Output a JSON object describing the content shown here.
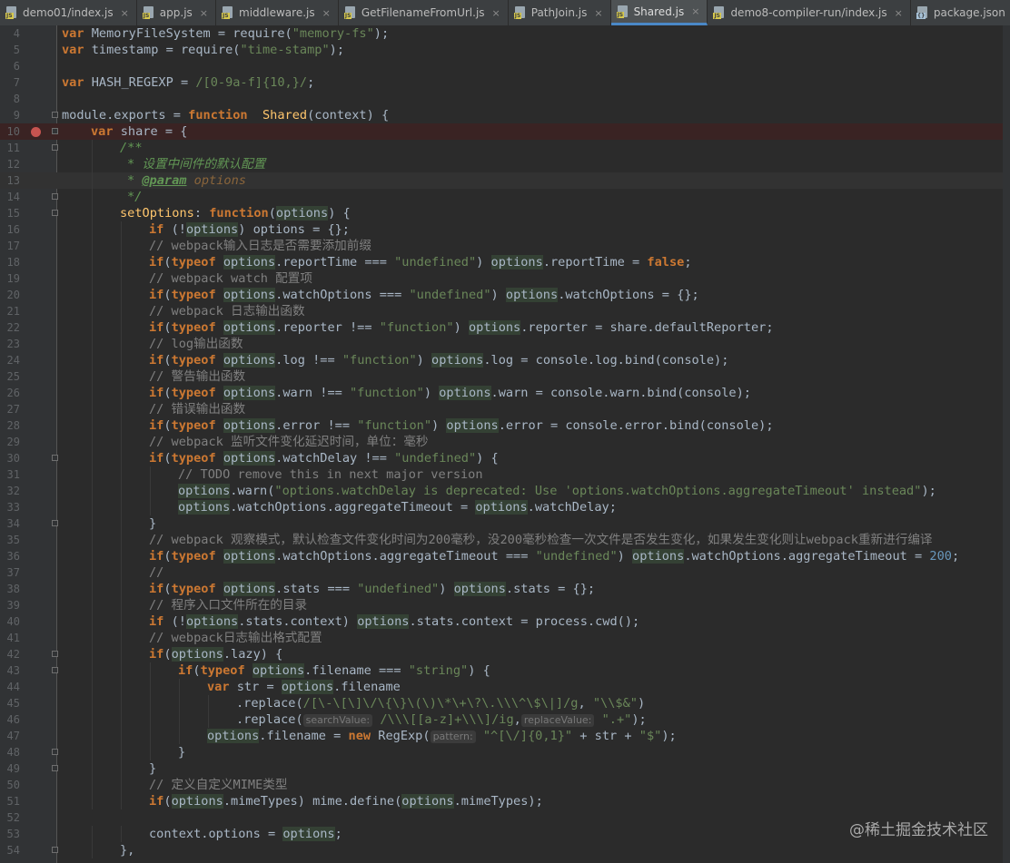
{
  "tabs": [
    {
      "label": "demo01/index.js",
      "icon": "js-file-icon",
      "active": false
    },
    {
      "label": "app.js",
      "icon": "js-file-icon",
      "active": false
    },
    {
      "label": "middleware.js",
      "icon": "js-file-icon",
      "active": false
    },
    {
      "label": "GetFilenameFromUrl.js",
      "icon": "js-file-icon",
      "active": false
    },
    {
      "label": "PathJoin.js",
      "icon": "js-file-icon",
      "active": false
    },
    {
      "label": "Shared.js",
      "icon": "js-file-icon",
      "active": true
    },
    {
      "label": "demo8-compiler-run/index.js",
      "icon": "js-file-icon",
      "active": false
    },
    {
      "label": "package.json",
      "icon": "json-file-icon",
      "active": false
    }
  ],
  "tab_close_glyph": "×",
  "line_numbers": [
    "4",
    "5",
    "6",
    "7",
    "8",
    "9",
    "10",
    "11",
    "12",
    "13",
    "14",
    "15",
    "16",
    "17",
    "18",
    "19",
    "20",
    "21",
    "22",
    "23",
    "24",
    "25",
    "26",
    "27",
    "28",
    "29",
    "30",
    "31",
    "32",
    "33",
    "34",
    "35",
    "36",
    "37",
    "38",
    "39",
    "40",
    "41",
    "42",
    "43",
    "44",
    "45",
    "46",
    "47",
    "48",
    "49",
    "50",
    "51",
    "52",
    "53",
    "54"
  ],
  "breakpoint_line": "10",
  "tokens": {
    "l4": [
      "var",
      "MemoryFileSystem = require(",
      "\"memory-fs\"",
      ");"
    ],
    "l5": [
      "var",
      "timestamp = require(",
      "\"time-stamp\"",
      ");"
    ],
    "l7": [
      "var",
      "HASH_REGEXP = ",
      "/[0-9a-f]{10,}/",
      ";"
    ],
    "l9": [
      "module.exports = ",
      "function",
      " ",
      "Shared",
      "(context) {"
    ],
    "l10": [
      "var",
      "share = {"
    ],
    "l11": [
      "/**"
    ],
    "l12": [
      "* 设置中间件的默认配置"
    ],
    "l13": [
      "*",
      "@param",
      "options"
    ],
    "l14": [
      "*/"
    ],
    "l15": [
      "setOptions",
      ": ",
      "function",
      "(",
      "options",
      ") {"
    ],
    "l16": [
      "if",
      "(!",
      "options",
      ") options = {};"
    ],
    "l17": [
      "// webpack输入日志是否需要添加前缀"
    ],
    "l18": [
      "if",
      "(",
      "typeof",
      "options",
      ".reportTime === ",
      "\"undefined\"",
      ") ",
      "options",
      ".reportTime = ",
      "false",
      ";"
    ],
    "l19": [
      "// webpack watch 配置项"
    ],
    "l20": [
      "if",
      "(",
      "typeof",
      "options",
      ".watchOptions === ",
      "\"undefined\"",
      ") ",
      "options",
      ".watchOptions = {};"
    ],
    "l21": [
      "// webpack 日志输出函数"
    ],
    "l22": [
      "if",
      "(",
      "typeof",
      "options",
      ".reporter !== ",
      "\"function\"",
      ") ",
      "options",
      ".reporter = share.defaultReporter;"
    ],
    "l23": [
      "// log输出函数"
    ],
    "l24": [
      "if",
      "(",
      "typeof",
      "options",
      ".log !== ",
      "\"function\"",
      ") ",
      "options",
      ".log = console.log.bind(console);"
    ],
    "l25": [
      "// 警告输出函数"
    ],
    "l26": [
      "if",
      "(",
      "typeof",
      "options",
      ".warn !== ",
      "\"function\"",
      ") ",
      "options",
      ".warn = console.warn.bind(console);"
    ],
    "l27": [
      "// 错误输出函数"
    ],
    "l28": [
      "if",
      "(",
      "typeof",
      "options",
      ".error !== ",
      "\"function\"",
      ") ",
      "options",
      ".error = console.error.bind(console);"
    ],
    "l29": [
      "// webpack 监听文件变化延迟时间，单位：毫秒"
    ],
    "l30": [
      "if",
      "(",
      "typeof",
      "options",
      ".watchDelay !== ",
      "\"undefined\"",
      ") {"
    ],
    "l31": [
      "// TODO remove this in next major version"
    ],
    "l32": [
      "options",
      ".warn(",
      "\"options.watchDelay is deprecated: Use 'options.watchOptions.aggregateTimeout' instead\"",
      ");"
    ],
    "l33": [
      "options",
      ".watchOptions.aggregateTimeout = ",
      "options",
      ".watchDelay;"
    ],
    "l34": [
      "}"
    ],
    "l35": [
      "// webpack 观察模式，默认检查文件变化时间为200毫秒，没200毫秒检查一次文件是否发生变化，如果发生变化则让webpack重新进行编译"
    ],
    "l36": [
      "if",
      "(",
      "typeof",
      "options",
      ".watchOptions.aggregateTimeout === ",
      "\"undefined\"",
      ") ",
      "options",
      ".watchOptions.aggregateTimeout = ",
      "200",
      ";"
    ],
    "l37": [
      "//"
    ],
    "l38": [
      "if",
      "(",
      "typeof",
      "options",
      ".stats === ",
      "\"undefined\"",
      ") ",
      "options",
      ".stats = {};"
    ],
    "l39": [
      "// 程序入口文件所在的目录"
    ],
    "l40": [
      "if",
      "(!",
      "options",
      ".stats.context) ",
      "options",
      ".stats.context = process.cwd();"
    ],
    "l41": [
      "// webpack日志输出格式配置"
    ],
    "l42": [
      "if",
      "(",
      "options",
      ".lazy) {"
    ],
    "l43": [
      "if",
      "(",
      "typeof",
      "options",
      ".filename === ",
      "\"string\"",
      ") {"
    ],
    "l44": [
      "var",
      "str = ",
      "options",
      ".filename"
    ],
    "l45": [
      ".replace(",
      "/[\\-\\[\\]\\/\\{\\}\\(\\)\\*\\+\\?\\.\\\\\\^\\$\\|]/g",
      ", ",
      "\"\\\\$&\"",
      ")"
    ],
    "l46": [
      ".replace(",
      "searchValue:",
      "/\\\\\\[[a-z]+\\\\\\]/ig",
      ",",
      "replaceValue:",
      "\".+\"",
      ");"
    ],
    "l47": [
      "options",
      ".filename = ",
      "new",
      "RegExp(",
      "pattern:",
      "\"^[\\/]{0,1}\"",
      " + str + ",
      "\"$\"",
      ");"
    ],
    "l48": [
      "}"
    ],
    "l49": [
      "}"
    ],
    "l50": [
      "// 定义自定义MIME类型"
    ],
    "l51": [
      "if",
      "(",
      "options",
      ".mimeTypes) mime.define(",
      "options",
      ".mimeTypes);"
    ],
    "l53": [
      "context.options = ",
      "options",
      ";"
    ],
    "l54": [
      "},"
    ]
  },
  "watermark": "@稀土掘金技术社区"
}
